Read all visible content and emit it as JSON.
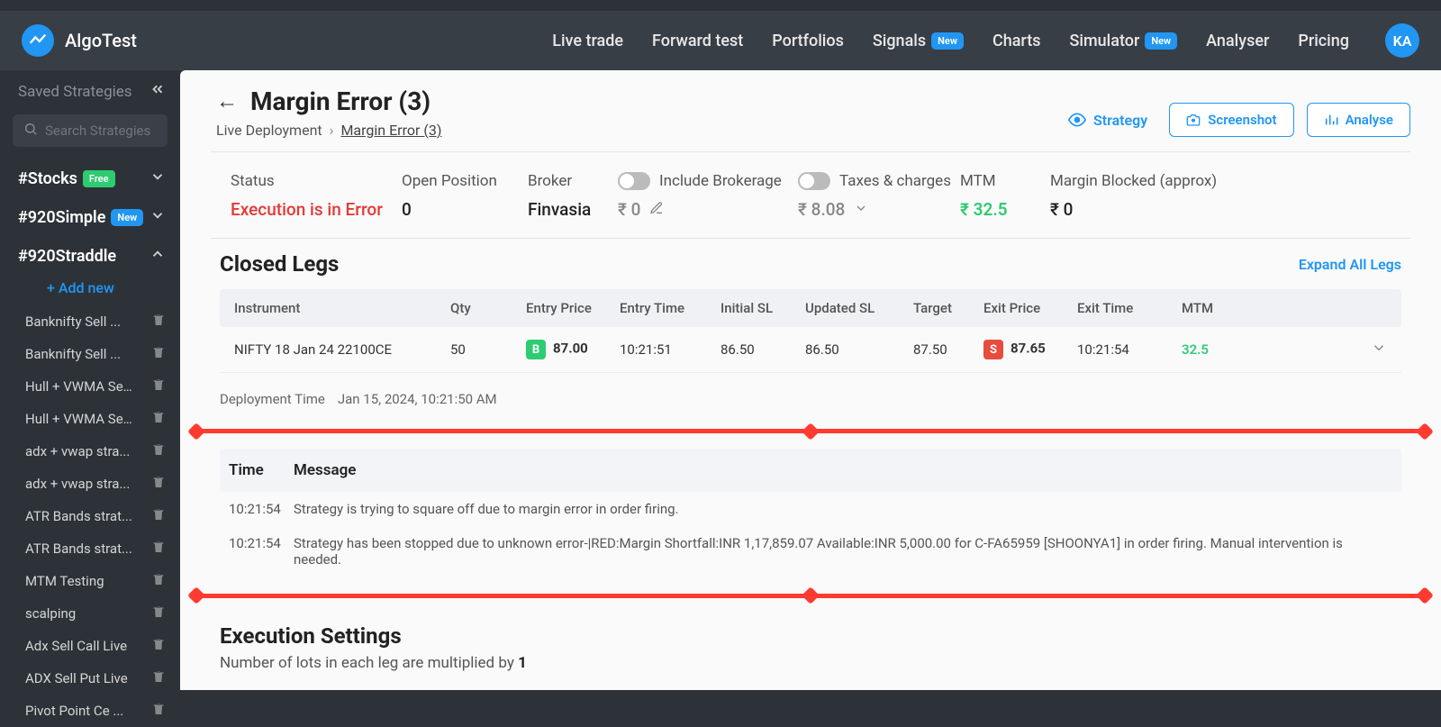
{
  "brand": "AlgoTest",
  "nav": {
    "live_trade": "Live trade",
    "forward_test": "Forward test",
    "portfolios": "Portfolios",
    "signals": "Signals",
    "charts": "Charts",
    "simulator": "Simulator",
    "analyser": "Analyser",
    "pricing": "Pricing",
    "badge_new": "New",
    "avatar": "KA"
  },
  "sidebar": {
    "saved_label": "Saved Strategies",
    "search_placeholder": "Search Strategies",
    "add_new": "+ Add new",
    "tags": {
      "stocks": "#Stocks",
      "simple920": "#920Simple",
      "straddle920": "#920Straddle",
      "free": "Free",
      "new": "New"
    },
    "items": [
      "Banknifty Sell ...",
      "Banknifty Sell ...",
      "Hull + VWMA Sel...",
      "Hull + VWMA Sel...",
      "adx + vwap stra...",
      "adx + vwap stra...",
      "ATR Bands strat...",
      "ATR Bands strat...",
      "MTM Testing",
      "scalping",
      "Adx Sell Call Live",
      "ADX Sell Put Live",
      "Pivot Point Ce ..."
    ]
  },
  "page": {
    "title": "Margin Error (3)",
    "breadcrumb_root": "Live Deployment",
    "breadcrumb_current": "Margin Error (3)",
    "strategy_label": "Strategy",
    "screenshot_btn": "Screenshot",
    "analyse_btn": "Analyse"
  },
  "status": {
    "status_label": "Status",
    "status_val": "Execution is in Error",
    "open_label": "Open Position",
    "open_val": "0",
    "broker_label": "Broker",
    "broker_val": "Finvasia",
    "include_brokerage": "Include Brokerage",
    "brokerage_val": "₹ 0",
    "taxes_label": "Taxes & charges",
    "taxes_val": "₹ 8.08",
    "mtm_label": "MTM",
    "mtm_val": "₹ 32.5",
    "margin_label": "Margin Blocked (approx)",
    "margin_val": "₹ 0"
  },
  "closed_legs": {
    "title": "Closed Legs",
    "expand": "Expand All Legs",
    "headers": {
      "instrument": "Instrument",
      "qty": "Qty",
      "entry_price": "Entry Price",
      "entry_time": "Entry Time",
      "initial_sl": "Initial SL",
      "updated_sl": "Updated SL",
      "target": "Target",
      "exit_price": "Exit Price",
      "exit_time": "Exit Time",
      "mtm": "MTM"
    },
    "row": {
      "instrument": "NIFTY 18 Jan 24 22100CE",
      "qty": "50",
      "entry_price": "87.00",
      "entry_time": "10:21:51",
      "initial_sl": "86.50",
      "updated_sl": "86.50",
      "target": "87.50",
      "exit_price": "87.65",
      "exit_time": "10:21:54",
      "mtm": "32.5",
      "buy_letter": "B",
      "sell_letter": "S"
    }
  },
  "deployment": {
    "label": "Deployment Time",
    "value": "Jan 15, 2024, 10:21:50 AM"
  },
  "log": {
    "time_hdr": "Time",
    "msg_hdr": "Message",
    "rows": [
      {
        "time": "10:21:54",
        "msg": "Strategy is trying to square off due to margin error in order firing."
      },
      {
        "time": "10:21:54",
        "msg": "Strategy has been stopped due to unknown error-|RED:Margin Shortfall:INR 1,17,859.07 Available:INR 5,000.00 for C-FA65959 [SHOONYA1] in order firing. Manual intervention is needed."
      }
    ]
  },
  "exec": {
    "title": "Execution Settings",
    "sub_prefix": "Number of lots in each leg are multiplied by ",
    "sub_bold": "1"
  }
}
